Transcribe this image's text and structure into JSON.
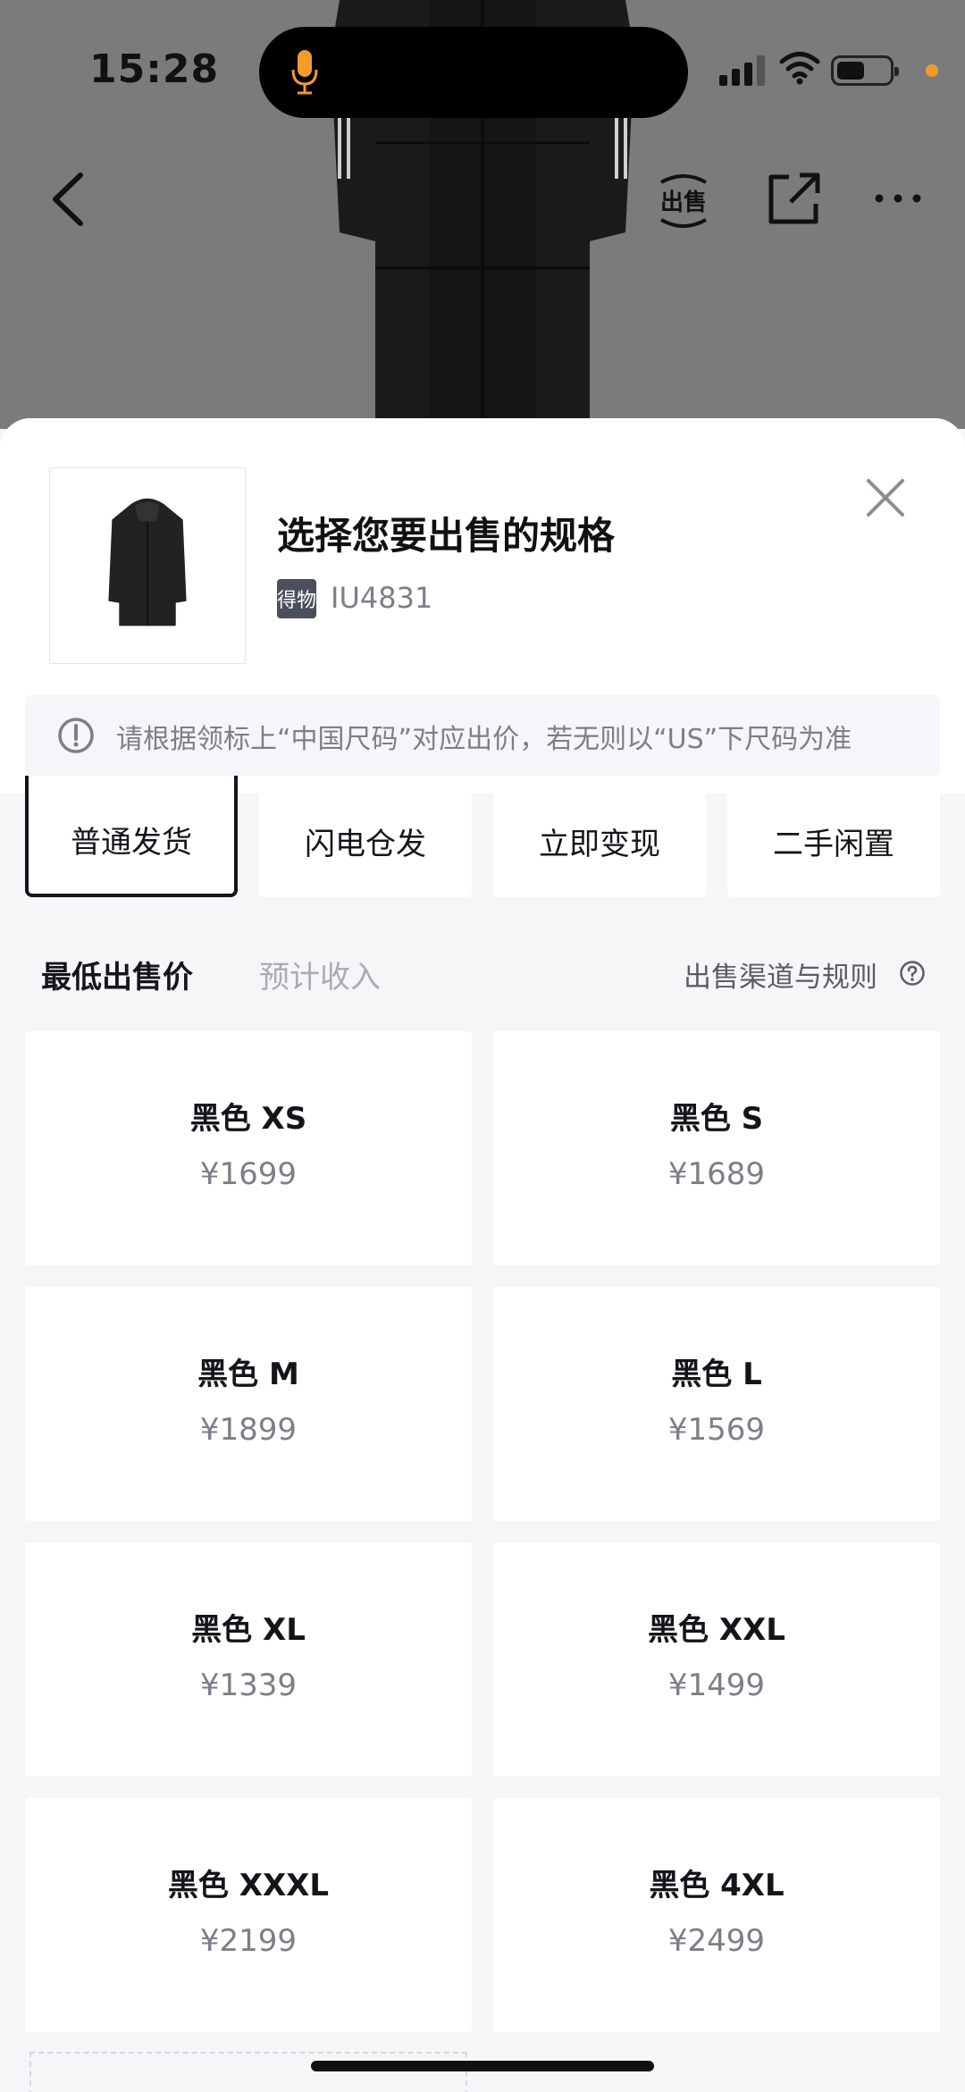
{
  "status": {
    "time": "15:28"
  },
  "nav": {
    "sell_label": "出售"
  },
  "sheet": {
    "title": "选择您要出售的规格",
    "brand_badge": "得物",
    "article_no": "IU4831",
    "notice": "请根据领标上“中国尺码”对应出价，若无则以“US”下尺码为准"
  },
  "tabs": [
    {
      "label": "普通发货",
      "active": true
    },
    {
      "label": "闪电仓发",
      "active": false
    },
    {
      "label": "立即变现",
      "active": false
    },
    {
      "label": "二手闲置",
      "active": false
    }
  ],
  "subtabs": {
    "active": "最低出售价",
    "inactive": "预计收入",
    "rules": "出售渠道与规则"
  },
  "sizes": [
    {
      "name": "黑色 XS",
      "price": "¥1699"
    },
    {
      "name": "黑色 S",
      "price": "¥1689"
    },
    {
      "name": "黑色 M",
      "price": "¥1899"
    },
    {
      "name": "黑色 L",
      "price": "¥1569"
    },
    {
      "name": "黑色 XL",
      "price": "¥1339"
    },
    {
      "name": "黑色 XXL",
      "price": "¥1499"
    },
    {
      "name": "黑色 XXXL",
      "price": "¥2199"
    },
    {
      "name": "黑色 4XL",
      "price": "¥2499"
    }
  ],
  "colors": {
    "accent_dot": "#f39a2c",
    "text_primary": "#14151a",
    "text_secondary": "#7c7f89"
  },
  "icons": [
    "mic-icon",
    "signal-icon",
    "wifi-icon",
    "battery-icon",
    "back-icon",
    "sell-icon",
    "share-icon",
    "more-icon",
    "close-icon",
    "alert-icon",
    "help-icon"
  ]
}
